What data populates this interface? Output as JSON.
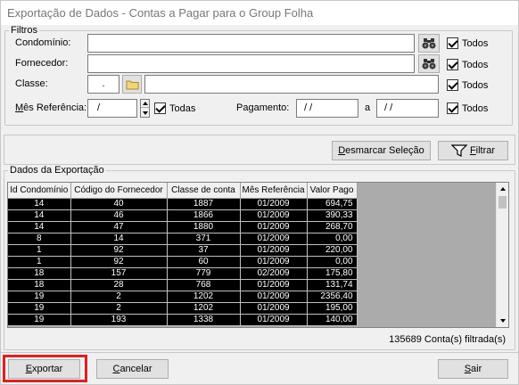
{
  "window": {
    "title": "Exportação de Dados - Contas a Pagar para o Group Folha"
  },
  "filters": {
    "legend": "Filtros",
    "condominio_label": "Condomínio:",
    "condominio_value": "",
    "fornecedor_label": "Fornecedor:",
    "fornecedor_value": "",
    "classe_label": "Classe:",
    "classe_code": ".",
    "classe_desc": "",
    "mes_label_underlined": "M",
    "mes_label_rest": "ês Referência:",
    "mes_value": "/",
    "pagamento_label": "Pagamento:",
    "pagamento_from": "/ /",
    "pagamento_to_label": "a",
    "pagamento_to": "/ /",
    "todos_label": "Todos",
    "todas_label": "Todas",
    "todos_condominio_checked": true,
    "todos_fornecedor_checked": true,
    "todos_classe_checked": true,
    "todas_mes_checked": true,
    "todos_pagamento_checked": true
  },
  "actions": {
    "desmarcar_u": "D",
    "desmarcar_rest": "esmarcar Seleção",
    "filtrar_u": "F",
    "filtrar_rest": "iltrar"
  },
  "export_data": {
    "legend": "Dados da Exportação",
    "columns": [
      "Id Condomínio",
      "Código do Fornecedor",
      "Classe de conta",
      "Mês Referência",
      "Valor Pago"
    ],
    "rows": [
      [
        "14",
        "40",
        "1887",
        "01/2009",
        "694,75"
      ],
      [
        "14",
        "46",
        "1866",
        "01/2009",
        "390,33"
      ],
      [
        "14",
        "47",
        "1880",
        "01/2009",
        "268,70"
      ],
      [
        "8",
        "14",
        "371",
        "01/2009",
        "0,00"
      ],
      [
        "1",
        "92",
        "37",
        "01/2009",
        "220,00"
      ],
      [
        "1",
        "92",
        "60",
        "01/2009",
        "0,00"
      ],
      [
        "18",
        "157",
        "779",
        "02/2009",
        "175,80"
      ],
      [
        "18",
        "28",
        "768",
        "01/2009",
        "131,74"
      ],
      [
        "19",
        "2",
        "1202",
        "01/2009",
        "2356,40"
      ],
      [
        "19",
        "2",
        "1202",
        "01/2009",
        "195,00"
      ],
      [
        "19",
        "193",
        "1338",
        "01/2009",
        "140,00"
      ]
    ],
    "status": "135689 Conta(s) filtrada(s)"
  },
  "footer": {
    "exportar_u": "E",
    "exportar_rest": "xportar",
    "cancelar_u": "C",
    "cancelar_rest": "ancelar",
    "sair_u": "S",
    "sair_rest": "air"
  },
  "colors": {
    "highlight": "#e02020",
    "selection_bg": "#000000",
    "selection_fg": "#ffffff"
  }
}
